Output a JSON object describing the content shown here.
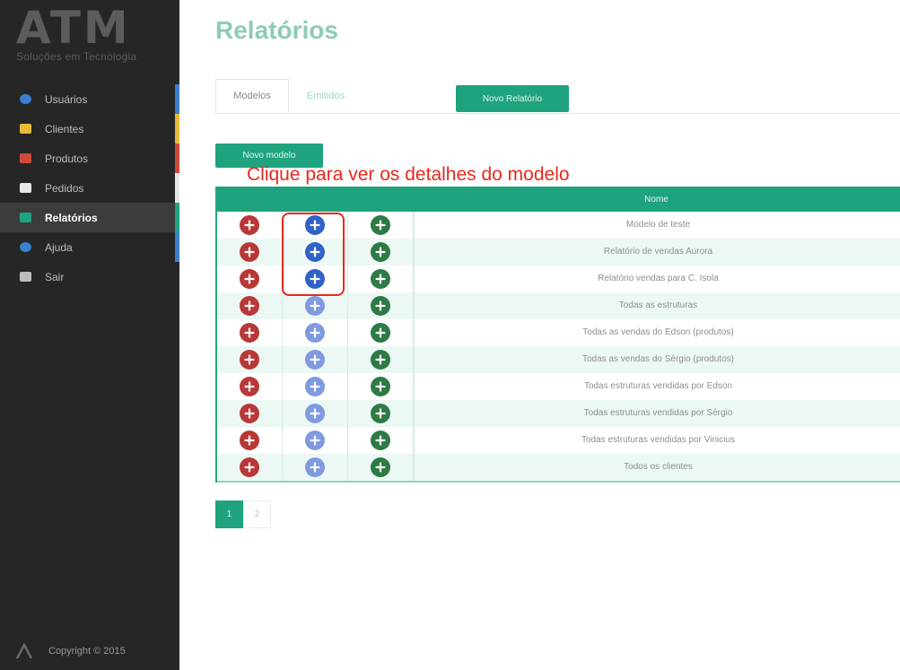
{
  "brand": {
    "logo_text": "ATM",
    "tagline": "Soluções em Tecnologia"
  },
  "sidebar": {
    "items": [
      {
        "label": "Usuários",
        "icon": "user-icon",
        "icon_color": "#3a7fd0",
        "mark_color": "#3a7fd0",
        "active": false
      },
      {
        "label": "Clientes",
        "icon": "envelope-icon",
        "icon_color": "#e8b93a",
        "mark_color": "#e8b93a",
        "active": false
      },
      {
        "label": "Produtos",
        "icon": "box-icon",
        "icon_color": "#d04a3a",
        "mark_color": "#d04a3a",
        "active": false
      },
      {
        "label": "Pedidos",
        "icon": "document-icon",
        "icon_color": "#e6e6e6",
        "mark_color": "#e6e6e6",
        "active": false
      },
      {
        "label": "Relatórios",
        "icon": "chart-icon",
        "icon_color": "#1fa37e",
        "mark_color": "#1fa37e",
        "active": true
      },
      {
        "label": "Ajuda",
        "icon": "help-icon",
        "icon_color": "#3a7fd0",
        "mark_color": "#3a7fd0",
        "active": false
      },
      {
        "label": "Sair",
        "icon": "logout-icon",
        "icon_color": "#bdbdbd",
        "mark_color": "",
        "active": false
      }
    ],
    "footer": "Copyright © 2015"
  },
  "page": {
    "title": "Relatórios",
    "tabs": [
      {
        "label": "Modelos",
        "active": true
      },
      {
        "label": "Emitidos",
        "active": false
      }
    ],
    "new_report_button": "Novo Relatório",
    "new_model_button": "Novo modelo",
    "annotation": "Clique para ver os detalhes do modelo"
  },
  "table": {
    "header_name": "Nome",
    "rows": [
      "Modelo de teste",
      "Relatório de vendas Aurora",
      "Relatório vendas para C. Isola",
      "Todas as estruturas",
      "Todas as vendas do Edson (produtos)",
      "Todas as vendas do Sérgio (produtos)",
      "Todas estruturas vendidas por Edson",
      "Todas estruturas vendidas por Sérgio",
      "Todas estruturas vendidas por Vinicius",
      "Todos os clientes"
    ]
  },
  "pagination": {
    "pages": [
      "1",
      "2"
    ],
    "current": "1"
  },
  "colors": {
    "accent": "#1fa37e",
    "title": "#8dcbb6",
    "annotation": "#e8281e",
    "delete": "#b83838",
    "details": "#2f63c8",
    "add": "#2e7a44"
  }
}
